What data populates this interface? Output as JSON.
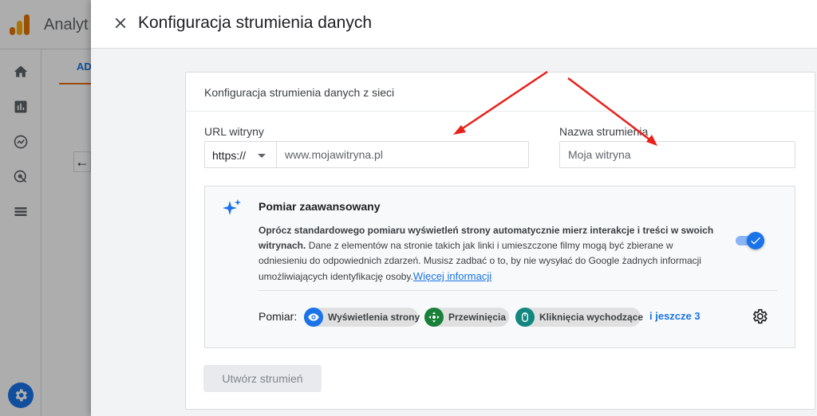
{
  "background": {
    "app_title": "Analyt",
    "tab_label": "AD"
  },
  "dialog": {
    "title": "Konfiguracja strumienia danych"
  },
  "card": {
    "header": "Konfiguracja strumienia danych z sieci",
    "url_label": "URL witryny",
    "protocol_value": "https://",
    "url_placeholder": "www.mojawitryna.pl",
    "name_label": "Nazwa strumienia",
    "name_placeholder": "Moja witryna"
  },
  "enhanced": {
    "title": "Pomiar zaawansowany",
    "desc_bold": "Oprócz standardowego pomiaru wyświetleń strony automatycznie mierz interakcje i treści w swoich witrynach.",
    "desc_rest": "Dane z elementów na stronie takich jak linki i umieszczone filmy mogą być zbierane w odniesieniu do odpowiednich zdarzeń. Musisz zadbać o to, by nie wysyłać do Google żadnych informacji umożliwiających identyfikację osoby.",
    "link": "Więcej informacji",
    "toggle_on": true,
    "measure_label": "Pomiar:",
    "chips": [
      {
        "label": "Wyświetlenia strony",
        "icon": "eye-icon",
        "color": "#1a73e8"
      },
      {
        "label": "Przewinięcia",
        "icon": "crosshair-icon",
        "color": "#188038"
      },
      {
        "label": "Kliknięcia wychodzące",
        "icon": "mouse-icon",
        "color": "#12877f"
      }
    ],
    "more": "i jeszcze 3"
  },
  "create_button": "Utwórz strumień",
  "colors": {
    "accent": "#1a73e8",
    "annotation": "#e8211c"
  }
}
